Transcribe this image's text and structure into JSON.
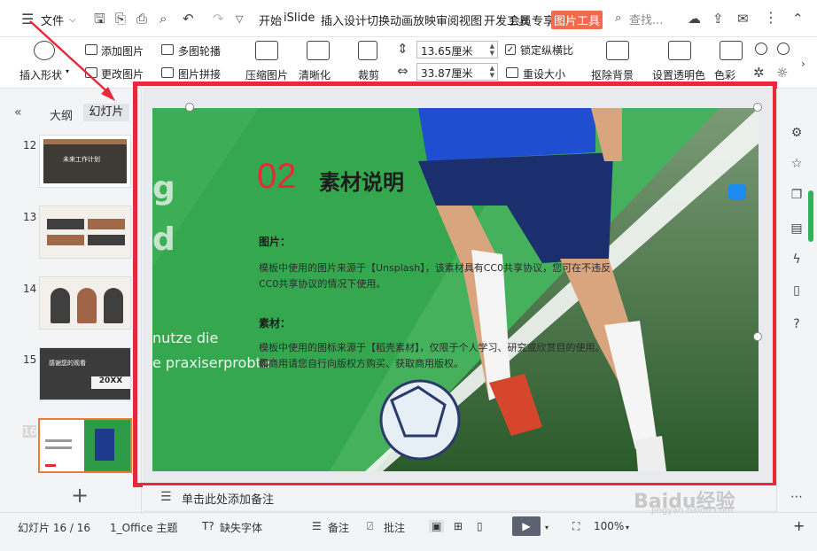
{
  "menubar": {
    "file_label": "文件",
    "tabs": [
      "开始",
      "iSlide",
      "插入",
      "设计",
      "切换",
      "动画",
      "放映",
      "审阅",
      "视图",
      "开发工具",
      "会员专享"
    ],
    "picture_tools_tab": "图片工具",
    "search_placeholder": "查找..."
  },
  "ribbon": {
    "insert_shape": "插入形状",
    "add_picture": "添加图片",
    "change_picture": "更改图片",
    "multi_carousel": "多图轮播",
    "picture_collage": "图片拼接",
    "compress_picture": "压缩图片",
    "sharpen": "清晰化",
    "crop": "裁剪",
    "width_value": "13.65厘米",
    "height_value": "33.87厘米",
    "lock_ratio_label": "锁定纵横比",
    "lock_ratio_checked": true,
    "reset_size": "重设大小",
    "remove_bg": "抠除背景",
    "set_transparent": "设置透明色",
    "color": "色彩"
  },
  "leftpane": {
    "outline_tab": "大纲",
    "slides_tab": "幻灯片",
    "slide_numbers": [
      "12",
      "13",
      "14",
      "15",
      "16"
    ],
    "thumb12_title": "未来工作计划",
    "thumb15_title": "感谢您的观看",
    "thumb15_year": "20XX"
  },
  "slide": {
    "number": "02",
    "title": "素材说明",
    "section1_heading": "图片：",
    "section1_line1": "模板中使用的图片来源于【Unsplash】，该素材具有CC0共享协议，您可在不违反",
    "section1_line2": "CC0共享协议的情况下使用。",
    "section2_heading": "素材：",
    "section2_line1": "模板中使用的图标来源于【稻壳素材】，仅限于个人学习、研究或欣赏目的使用。如",
    "section2_line2": "需商用请您自行向版权方购买、获取商用版权。",
    "side_text1": "g",
    "side_text2": "d",
    "side_text3": "nutze die",
    "side_text4": "e praxiserprobte"
  },
  "notes": {
    "placeholder": "单击此处添加备注"
  },
  "statusbar": {
    "slide_counter": "幻灯片 16 / 16",
    "theme": "1_Office 主题",
    "missing_font": "缺失字体",
    "notes": "备注",
    "comments": "批注",
    "zoom": "100%"
  },
  "watermark": {
    "line1": "Baidu经验",
    "line2": "jingyan.baidu.com"
  },
  "colors": {
    "accent_red": "#e8293a",
    "picture_tab": "#f06a4e",
    "slide_green": "#2e9b48"
  }
}
